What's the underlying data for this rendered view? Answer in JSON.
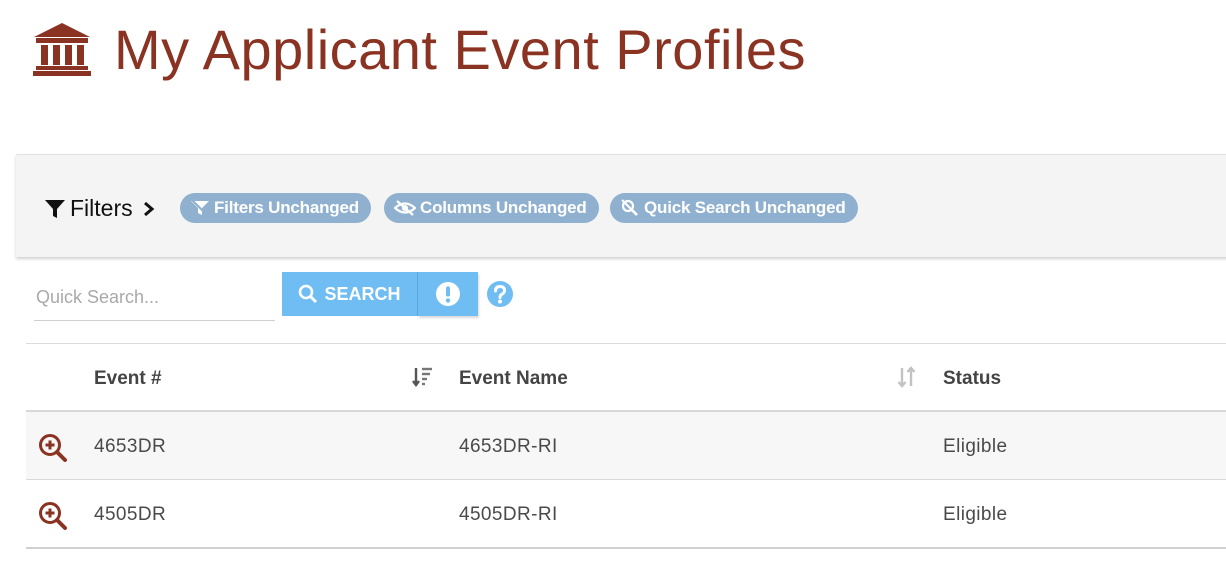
{
  "page": {
    "title": "My Applicant Event Profiles",
    "title_icon": "institution-icon",
    "accent_color": "#8b3322"
  },
  "filter_bar": {
    "toggle_label": "Filters",
    "chips": [
      {
        "label": "Filters Unchanged",
        "icon": "filter-icon"
      },
      {
        "label": "Columns Unchanged",
        "icon": "hidden-eye-icon"
      },
      {
        "label": "Quick Search Unchanged",
        "icon": "search-off-icon"
      }
    ],
    "chip_color": "#8fb1cf"
  },
  "search": {
    "placeholder": "Quick Search...",
    "value": "",
    "button_label": "SEARCH",
    "button_color": "#6fbdf2"
  },
  "table": {
    "columns": [
      {
        "label": "Event #"
      },
      {
        "label": "Event Name"
      },
      {
        "label": "Status"
      }
    ],
    "rows": [
      {
        "event_number": "4653DR",
        "event_name": "4653DR-RI",
        "status": "Eligible"
      },
      {
        "event_number": "4505DR",
        "event_name": "4505DR-RI",
        "status": "Eligible"
      }
    ]
  }
}
